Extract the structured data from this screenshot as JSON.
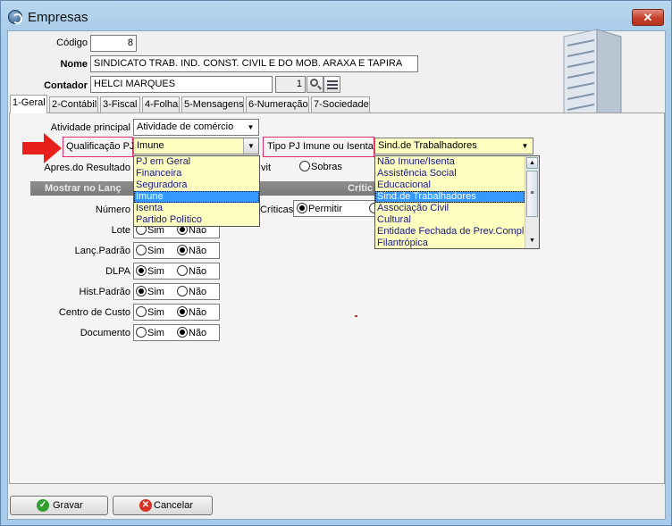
{
  "window": {
    "title": "Empresas",
    "close_label": "✕"
  },
  "form": {
    "codigo_label": "Código",
    "codigo_value": "8",
    "nome_label": "Nome",
    "nome_value": "SINDICATO TRAB. IND. CONST. CIVIL E DO MOB. ARAXA E TAPIRA",
    "contador_label": "Contador",
    "contador_value": "HELCI MARQUES",
    "contador_code": "1"
  },
  "tabs": [
    {
      "label": "1-Geral"
    },
    {
      "label": "2-Contábil"
    },
    {
      "label": "3-Fiscal"
    },
    {
      "label": "4-Folha"
    },
    {
      "label": "5-Mensagens"
    },
    {
      "label": "6-Numeração"
    },
    {
      "label": "7-Sociedade"
    }
  ],
  "geral": {
    "atividade_label": "Atividade principal",
    "atividade_value": "Atividade de comércio",
    "qualificacao_label": "Qualificação PJ",
    "qualificacao_value": "Imune",
    "qualificacao_options": [
      "PJ em Geral",
      "Financeira",
      "Seguradora",
      "Imune",
      "Isenta",
      "Partido Político"
    ],
    "tipo_label": "Tipo PJ Imune ou Isenta",
    "tipo_value": "Sind.de Trabalhadores",
    "tipo_options": [
      "Não Imune/Isenta",
      "Assistência Social",
      "Educacional",
      "Sind.de Trabalhadores",
      "Associação Civil",
      "Cultural",
      "Entidade Fechada de Prev.Compl.",
      "Filantrópica"
    ],
    "apres_label": "Apres.do Resultado",
    "apres_partial": "vit",
    "apres_sobras": "Sobras",
    "mostrar_header": "Mostrar no Lanç",
    "criticas_header": "Crític",
    "criticas_label": "Críticas",
    "criticas_permitir": "Permitir",
    "rows": [
      {
        "label": "Número",
        "value": ""
      },
      {
        "label": "Lote",
        "value": "Não"
      },
      {
        "label": "Lanç.Padrão",
        "value": "Não"
      },
      {
        "label": "DLPA",
        "value": "Sim"
      },
      {
        "label": "Hist.Padrão",
        "value": "Sim"
      },
      {
        "label": "Centro de Custo",
        "value": "Não"
      },
      {
        "label": "Documento",
        "value": "Não"
      }
    ],
    "sim_label": "Sim",
    "nao_label": "Não"
  },
  "buttons": {
    "gravar": "Gravar",
    "cancelar": "Cancelar"
  },
  "colors": {
    "accent": "#3399ff",
    "highlight": "#fdfdbf",
    "arrow": "#e8201c"
  }
}
